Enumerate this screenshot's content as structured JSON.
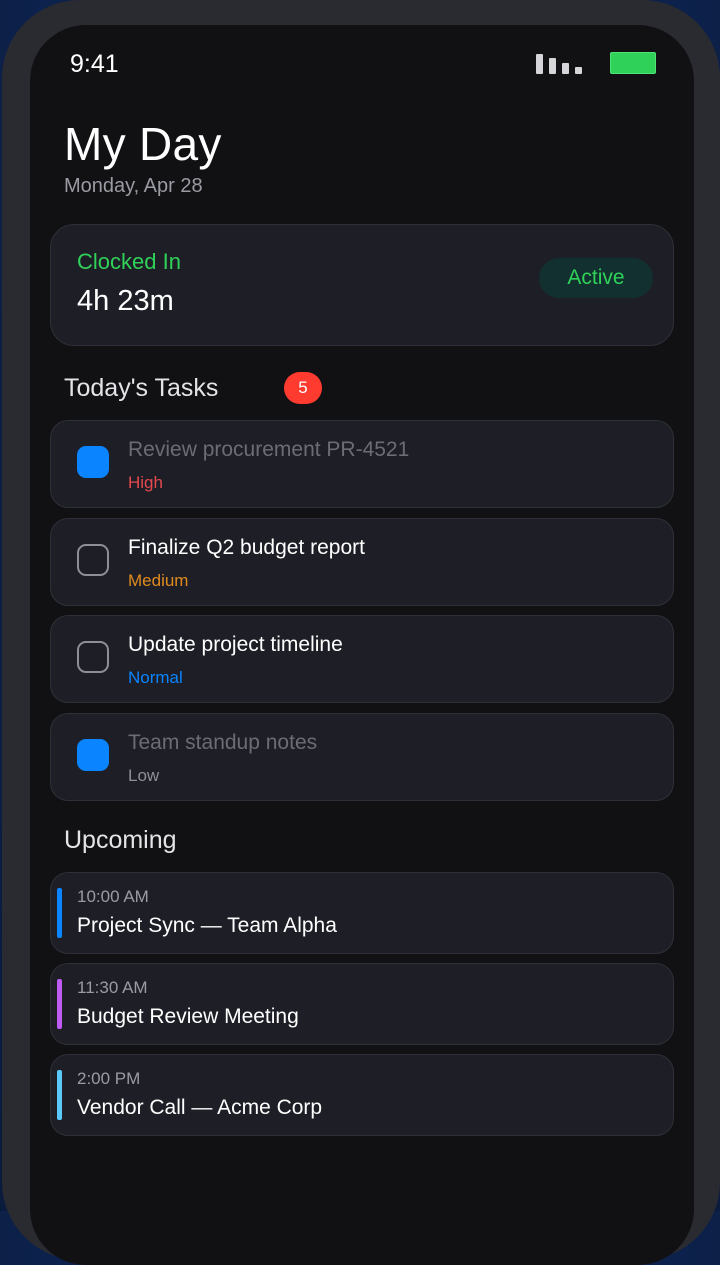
{
  "status_bar": {
    "time": "9:41"
  },
  "header": {
    "title": "My Day",
    "date": "Monday, Apr 28"
  },
  "clock": {
    "label": "Clocked In",
    "duration": "4h 23m",
    "status": "Active"
  },
  "tasks": {
    "heading": "Today's Tasks",
    "count": "5",
    "items": [
      {
        "title": "Review procurement PR-4521",
        "priority": "High",
        "priority_color": "#e5484d",
        "completed": true
      },
      {
        "title": "Finalize Q2 budget report",
        "priority": "Medium",
        "priority_color": "#e08a1e",
        "completed": false
      },
      {
        "title": "Update project timeline",
        "priority": "Normal",
        "priority_color": "#0a84ff",
        "completed": false
      },
      {
        "title": "Team standup notes",
        "priority": "Low",
        "priority_color": "#8e8e96",
        "completed": true
      }
    ]
  },
  "upcoming": {
    "heading": "Upcoming",
    "items": [
      {
        "time": "10:00 AM",
        "title": "Project Sync — Team Alpha",
        "color": "#0a84ff"
      },
      {
        "time": "11:30 AM",
        "title": "Budget Review Meeting",
        "color": "#bf5af2"
      },
      {
        "time": "2:00 PM",
        "title": "Vendor Call — Acme Corp",
        "color": "#5ac8fa"
      }
    ]
  }
}
